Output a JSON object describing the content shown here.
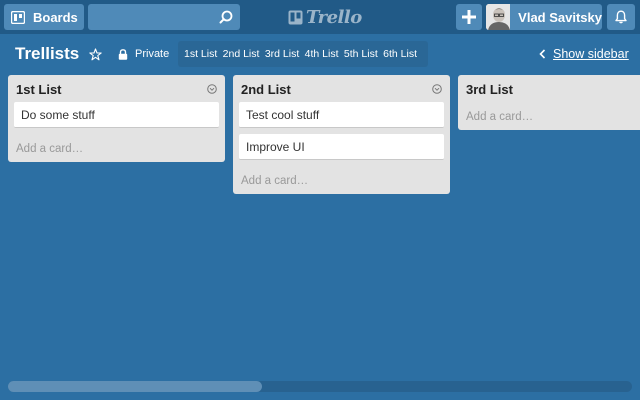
{
  "header": {
    "boards_label": "Boards",
    "search": {
      "value": "",
      "placeholder": ""
    },
    "logo_text": "Trello",
    "user_name": "Vlad Savitsky"
  },
  "board": {
    "title": "Trellists",
    "privacy_label": "Private",
    "list_nav": [
      "1st List",
      "2nd List",
      "3rd List",
      "4th List",
      "5th List",
      "6th List"
    ],
    "show_sidebar_label": "Show sidebar"
  },
  "lists": [
    {
      "title": "1st List",
      "cards": [
        "Do some stuff"
      ],
      "add_card_label": "Add a card…"
    },
    {
      "title": "2nd List",
      "cards": [
        "Test cool stuff",
        "Improve UI"
      ],
      "add_card_label": "Add a card…"
    },
    {
      "title": "3rd List",
      "cards": [],
      "add_card_label": "Add a card…"
    }
  ],
  "icons": {
    "boards": "boards-icon",
    "search": "search-icon",
    "logo": "trello-logo-icon",
    "add": "plus-icon",
    "notifications": "bell-icon",
    "star": "star-icon",
    "privacy": "lock-icon",
    "list_menu": "chevron-down-circle-icon",
    "sidebar": "chevron-left-icon"
  },
  "colors": {
    "board_background": "#2c6fa3",
    "header_background": "#215a87",
    "header_button": "#4f8ab8",
    "list_background": "#e3e3e3"
  }
}
